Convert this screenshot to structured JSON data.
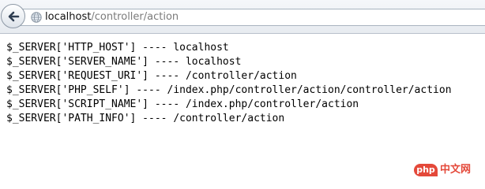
{
  "browser": {
    "url_host": "localhost",
    "url_path": "/controller/action"
  },
  "output": {
    "lines": [
      "$_SERVER['HTTP_HOST'] ---- localhost",
      "$_SERVER['SERVER_NAME'] ---- localhost",
      "$_SERVER['REQUEST_URI'] ---- /controller/action",
      "$_SERVER['PHP_SELF'] ---- /index.php/controller/action/controller/action",
      "$_SERVER['SCRIPT_NAME'] ---- /index.php/controller/action",
      "$_SERVER['PATH_INFO'] ---- /controller/action"
    ]
  },
  "watermark": {
    "logo_text": "php",
    "site_text": "中文网"
  },
  "colors": {
    "watermark_red": "#e4493a"
  },
  "icons": {
    "back": "back-arrow-icon",
    "site": "globe-icon"
  }
}
